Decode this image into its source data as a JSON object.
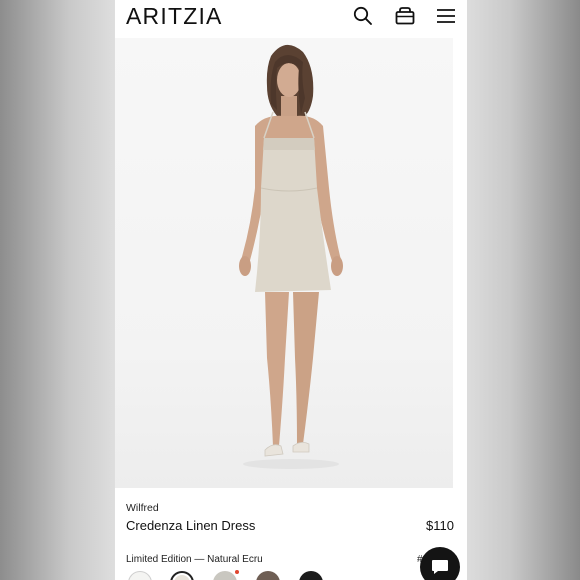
{
  "header": {
    "logo": "ARITZIA",
    "icons": [
      "search-icon",
      "shopping-bag-icon",
      "hamburger-menu-icon"
    ]
  },
  "product": {
    "brand": "Wilfred",
    "name": "Credenza Linen Dress",
    "price": "$110",
    "color_label": "Limited Edition — Natural Ecru",
    "color_code": "#",
    "swatches": [
      {
        "name": "white",
        "color": "#f4f4f2"
      },
      {
        "name": "natural-ecru",
        "color": "#e8e3da",
        "selected": true
      },
      {
        "name": "grey",
        "color": "#c9c7c0"
      },
      {
        "name": "brown",
        "color": "#6e5e54"
      },
      {
        "name": "black",
        "color": "#1c1c1c"
      }
    ]
  },
  "chat": {
    "icon": "chat-bubble-icon"
  }
}
